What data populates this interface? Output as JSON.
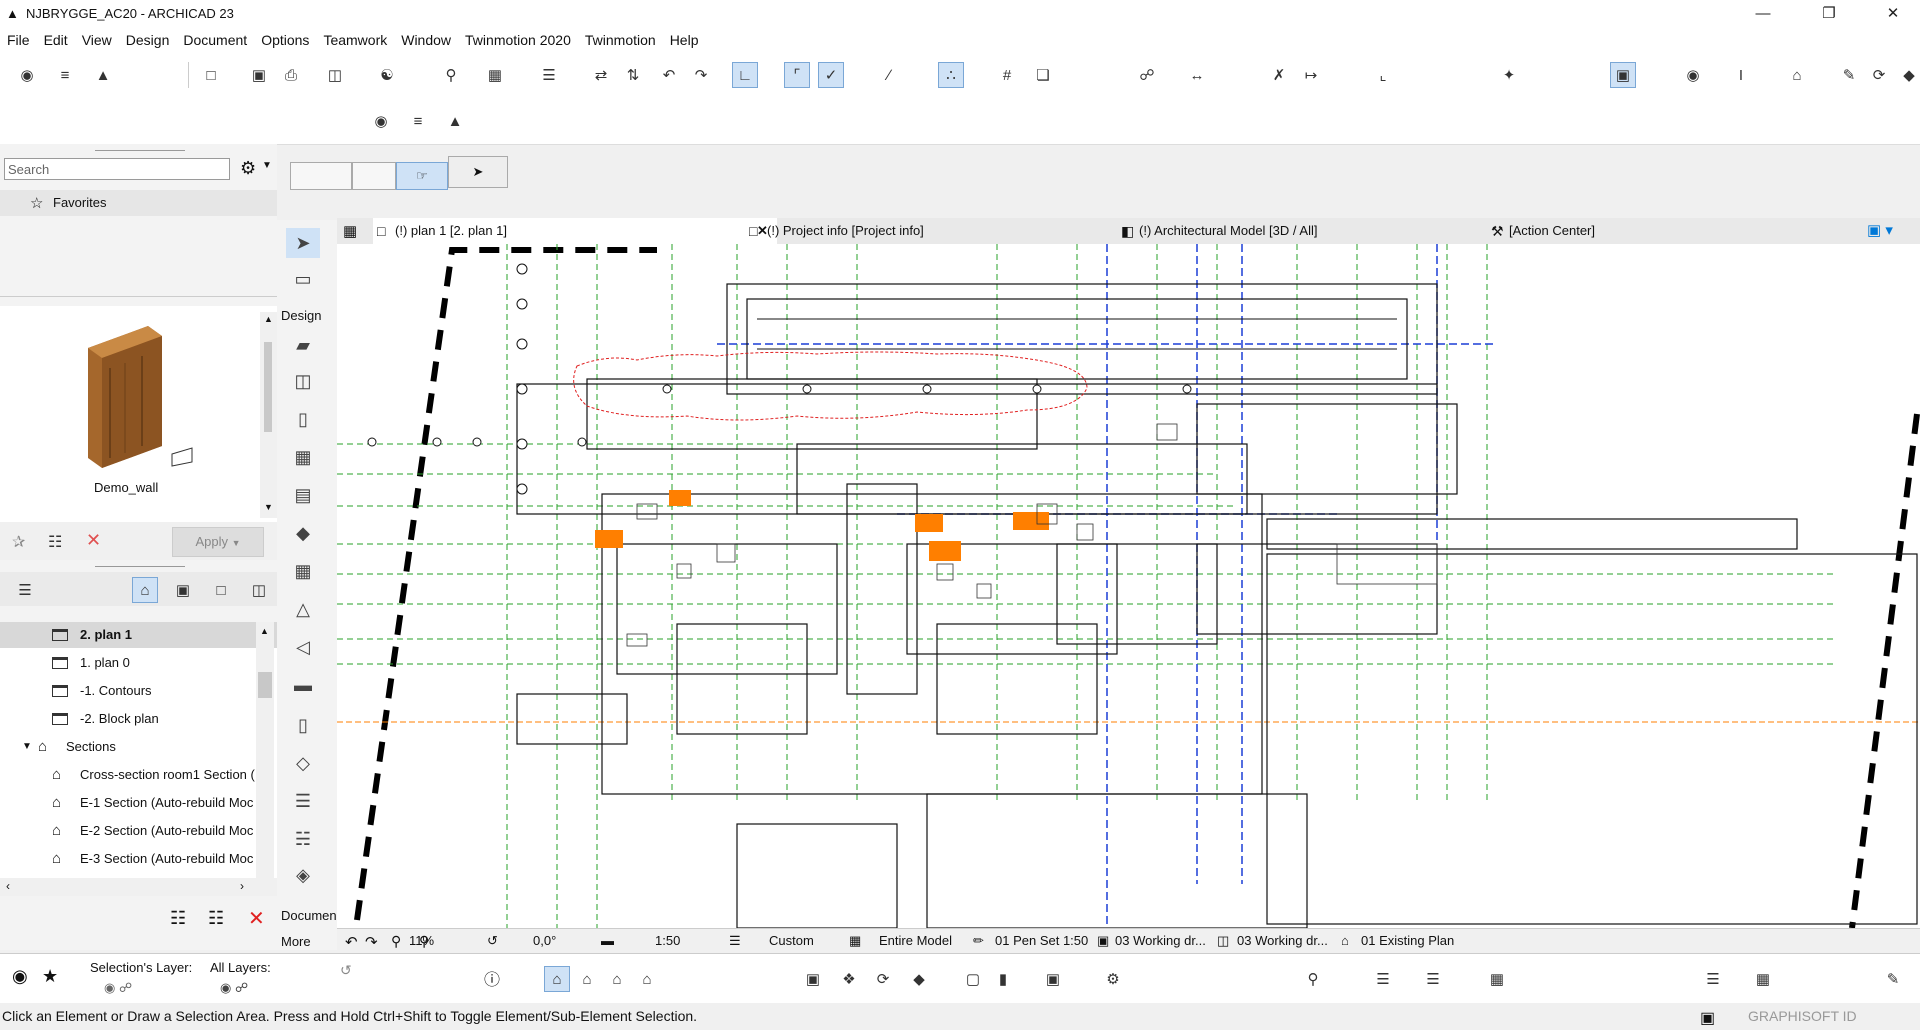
{
  "window": {
    "title": "NJBRYGGE_AC20 - ARCHICAD 23"
  },
  "menu": [
    "File",
    "Edit",
    "View",
    "Design",
    "Document",
    "Options",
    "Teamwork",
    "Window",
    "Twinmotion 2020",
    "Twinmotion",
    "Help"
  ],
  "left_panel": {
    "search_placeholder": "Search",
    "favorites_label": "Favorites",
    "preview_name": "Demo_wall",
    "apply_label": "Apply",
    "navigator": [
      {
        "label": "2. plan 1",
        "selected": true,
        "type": "story"
      },
      {
        "label": "1. plan 0",
        "type": "story"
      },
      {
        "label": "-1. Contours",
        "type": "story"
      },
      {
        "label": "-2. Block plan",
        "type": "story"
      },
      {
        "label": "Sections",
        "type": "group"
      },
      {
        "label": "Cross-section room1 Section (",
        "type": "section"
      },
      {
        "label": "E-1 Section (Auto-rebuild Moc",
        "type": "section"
      },
      {
        "label": "E-2 Section (Auto-rebuild Moc",
        "type": "section"
      },
      {
        "label": "E-3 Section (Auto-rebuild Moc",
        "type": "section"
      }
    ]
  },
  "toolbox": {
    "design_label": "Design",
    "document_label": "Documen",
    "more_label": "More"
  },
  "tabs": [
    {
      "label": "(!) plan 1 [2. plan 1]",
      "active": true
    },
    {
      "label": "(!) Project info [Project info]"
    },
    {
      "label": "(!) Architectural Model [3D / All]"
    },
    {
      "label": "[Action Center]"
    }
  ],
  "quick_options": {
    "zoom": "11%",
    "angle": "0,0°",
    "scale": "1:50",
    "layer_combo": "Custom",
    "model_view": "Entire Model",
    "pen_set": "01 Pen Set 1:50",
    "graphic_override": "03 Working dr...",
    "model_view_option": "03 Working dr...",
    "renovation": "01 Existing Plan"
  },
  "infobox": {
    "selection_layer_label": "Selection's Layer:",
    "all_layers_label": "All Layers:"
  },
  "status": {
    "message": "Click an Element or Draw a Selection Area. Press and Hold Ctrl+Shift to Toggle Element/Sub-Element Selection.",
    "brand": "GRAPHISOFT ID"
  },
  "colors": {
    "accent": "#0078d7",
    "highlight": "#ff7f00",
    "grid": "#2aa02a",
    "blue_lines": "#1c3fd6",
    "revision_cloud": "#e02020"
  }
}
